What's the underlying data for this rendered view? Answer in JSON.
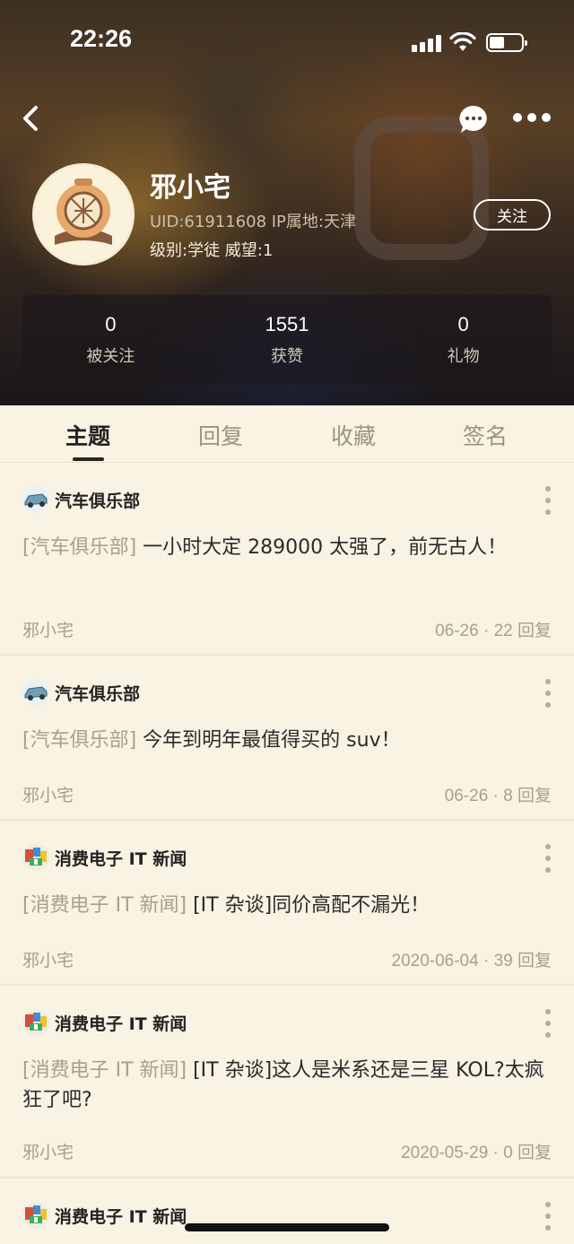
{
  "status_bar": {
    "time": "22:26"
  },
  "profile": {
    "nickname": "邪小宅",
    "uid_line": "UID:61911608  IP属地:天津",
    "level_line": "级别:学徒  威望:1",
    "follow_label": "关注"
  },
  "stats": [
    {
      "value": "0",
      "label": "被关注"
    },
    {
      "value": "1551",
      "label": "获赞"
    },
    {
      "value": "0",
      "label": "礼物"
    }
  ],
  "tabs": [
    {
      "label": "主题",
      "active": true
    },
    {
      "label": "回复",
      "active": false
    },
    {
      "label": "收藏",
      "active": false
    },
    {
      "label": "签名",
      "active": false
    }
  ],
  "posts": [
    {
      "forum": "汽车俱乐部",
      "forum_icon": "car-icon",
      "tag": "[汽车俱乐部]",
      "title": " 一小时大定 289000 太强了，前无古人！",
      "author": "邪小宅",
      "meta": "06-26 · 22 回复"
    },
    {
      "forum": "汽车俱乐部",
      "forum_icon": "car-icon",
      "tag": "[汽车俱乐部]",
      "title": " 今年到明年最值得买的 suv！",
      "author": "邪小宅",
      "meta": "06-26 · 8 回复"
    },
    {
      "forum": "消费电子 IT 新闻",
      "forum_icon": "gadget-icon",
      "tag": "[消费电子 IT 新闻]",
      "title": " [IT 杂谈]同价高配不漏光！",
      "author": "邪小宅",
      "meta": "2020-06-04 · 39 回复"
    },
    {
      "forum": "消费电子 IT 新闻",
      "forum_icon": "gadget-icon",
      "tag": "[消费电子 IT 新闻]",
      "title": " [IT 杂谈]这人是米系还是三星 KOL?太疯狂了吧?",
      "author": "邪小宅",
      "meta": "2020-05-29 · 0 回复"
    },
    {
      "forum": "消费电子 IT 新闻",
      "forum_icon": "gadget-icon",
      "tag": "",
      "title": "",
      "author": "",
      "meta": ""
    }
  ]
}
